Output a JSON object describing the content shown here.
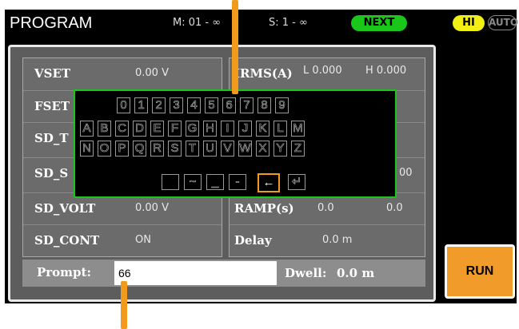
{
  "header": {
    "title": "PROGRAM",
    "m_status": "M: 01 - ∞",
    "s_status": "S: 1 - ∞",
    "next_badge": "NEXT",
    "hi_badge": "HI",
    "auto_badge": "AUTO"
  },
  "left_rows": [
    {
      "label": "VSET",
      "value": "0.00 V"
    },
    {
      "label": "FSET",
      "value": ""
    },
    {
      "label": "SD_T",
      "value": ""
    },
    {
      "label": "SD_S",
      "value": ""
    },
    {
      "label": "SD_VOLT",
      "value": "0.00 V"
    },
    {
      "label": "SD_CONT",
      "value": "ON"
    }
  ],
  "right_rows": [
    {
      "label": "IRMS(A)",
      "value_low": "L 0.000",
      "value_high": "H 0.000"
    },
    {
      "label": "",
      "value_low": "",
      "value_high": ""
    },
    {
      "label": "",
      "value_low": "",
      "value_high": ""
    },
    {
      "label": "",
      "value_low": "",
      "value_high": "00"
    },
    {
      "label": "RAMP(s)",
      "value_low": "0.0",
      "value_high": "0.0"
    },
    {
      "label": "Delay",
      "value_low": "0.0 m",
      "value_high": ""
    }
  ],
  "prompt": {
    "label": "Prompt:",
    "value": "66"
  },
  "dwell": {
    "label": "Dwell:",
    "value": "0.0 m"
  },
  "run_button": "RUN",
  "keyboard": {
    "row1": [
      "0",
      "1",
      "2",
      "3",
      "4",
      "5",
      "6",
      "7",
      "8",
      "9"
    ],
    "row2": [
      "A",
      "B",
      "C",
      "D",
      "E",
      "F",
      "G",
      "H",
      "I",
      "J",
      "K",
      "L",
      "M"
    ],
    "row3": [
      "N",
      "O",
      "P",
      "Q",
      "R",
      "S",
      "T",
      "U",
      "V",
      "W",
      "X",
      "Y",
      "Z"
    ],
    "row4": [
      " ",
      "~",
      "_",
      "-",
      "←",
      "↵"
    ],
    "selected": "←"
  },
  "colors": {
    "accent_green": "#19c619",
    "accent_yellow": "#f2ef15",
    "accent_orange": "#f29a1c",
    "panel_gray": "#6b6b6b"
  }
}
